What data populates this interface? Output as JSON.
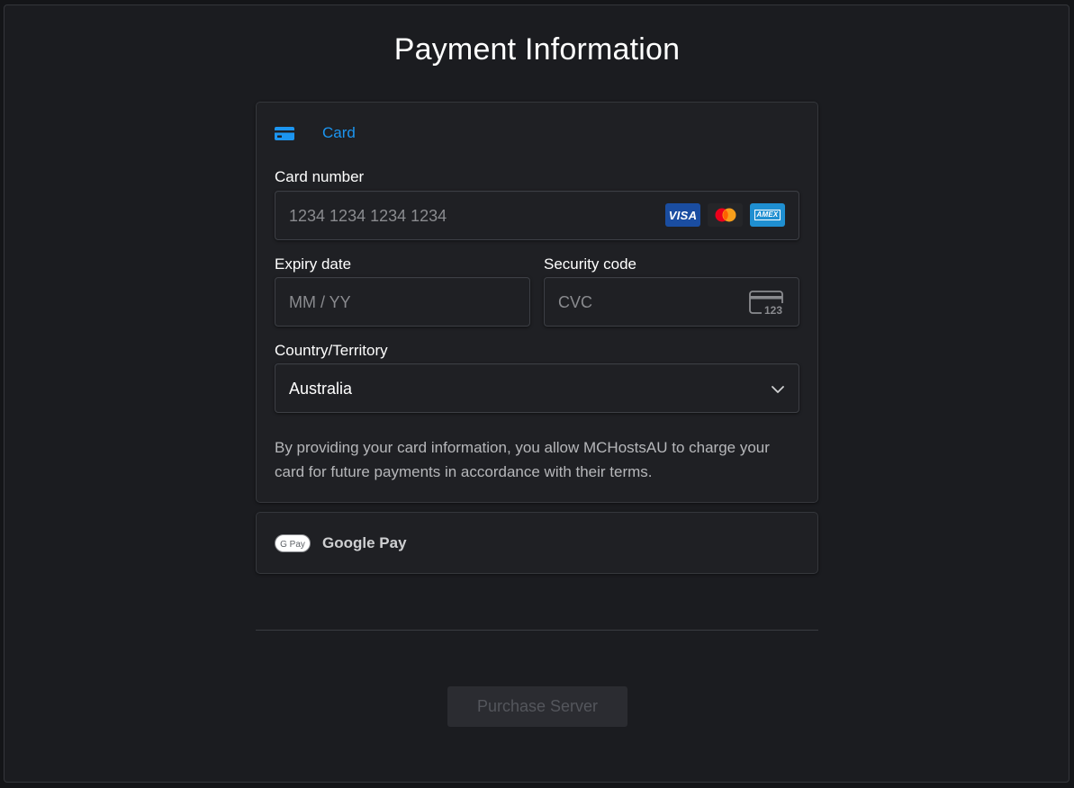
{
  "page": {
    "title": "Payment Information"
  },
  "payment_methods": {
    "card_tab": {
      "label": "Card",
      "icon": "credit-card-icon",
      "accent_color": "#1c95f0",
      "selected": true
    },
    "google_pay": {
      "label": "Google Pay",
      "icon": "google-pay-icon",
      "logo_text": "G Pay"
    }
  },
  "card_form": {
    "card_number": {
      "label": "Card number",
      "placeholder": "1234 1234 1234 1234",
      "brands": [
        {
          "name": "visa-icon",
          "text": "VISA"
        },
        {
          "name": "mastercard-icon",
          "text": ""
        },
        {
          "name": "amex-icon",
          "text": "AMEX"
        }
      ]
    },
    "expiry": {
      "label": "Expiry date",
      "placeholder": "MM / YY"
    },
    "security_code": {
      "label": "Security code",
      "placeholder": "CVC",
      "icon_text": "123"
    },
    "country": {
      "label": "Country/Territory",
      "value": "Australia"
    },
    "disclaimer": "By providing your card information, you allow MCHostsAU to charge your card for future payments in accordance with their terms."
  },
  "actions": {
    "purchase_label": "Purchase Server",
    "purchase_enabled": false
  }
}
